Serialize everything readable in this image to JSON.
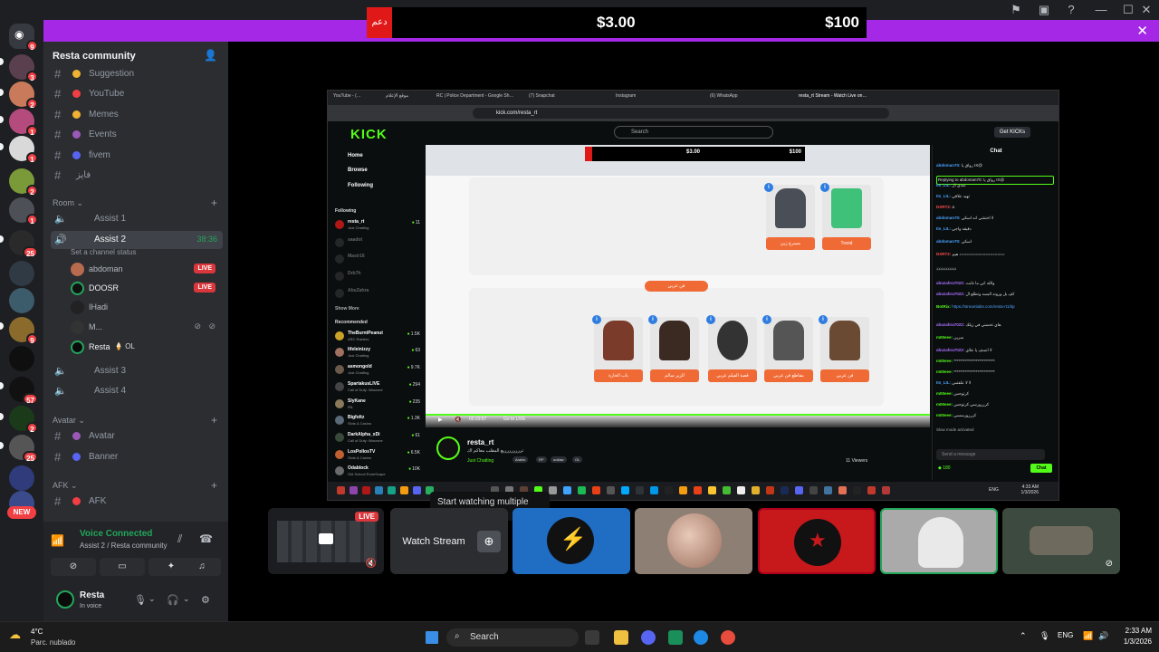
{
  "window": {
    "controls": [
      "flag-icon",
      "inbox-icon",
      "help-icon",
      "minimize",
      "maximize",
      "close"
    ]
  },
  "stream_overlay": {
    "left_text": "دعم",
    "amount_1": "$3.00",
    "amount_2": "$100"
  },
  "rail": {
    "new_label": "NEW",
    "badges": [
      "9",
      "3",
      "2",
      "1",
      "1",
      "2",
      "1",
      "25",
      "9",
      "57",
      "2",
      "25"
    ]
  },
  "server": {
    "name": "Resta community"
  },
  "channels": [
    {
      "label": "Suggestion",
      "color": "#f0b232"
    },
    {
      "label": "YouTube",
      "color": "#f23f43"
    },
    {
      "label": "Memes",
      "color": "#f0b232"
    },
    {
      "label": "Events",
      "color": "#9b59b6"
    },
    {
      "label": "fivem",
      "color": "#5865f2"
    },
    {
      "label": "فايز",
      "color": ""
    }
  ],
  "categories": {
    "room": "Room",
    "avatar": "Avatar",
    "afk": "AFK"
  },
  "voice_channels": {
    "assist1": "Assist 1",
    "assist2": "Assist 2",
    "assist2_time": "38:36",
    "assist2_status": "Set a channel status",
    "assist3": "Assist 3",
    "assist4": "Assist 4",
    "avatar": "Avatar",
    "banner": "Banner",
    "afk": "AFK"
  },
  "voice_users": [
    {
      "name": "abdoman",
      "live": "LIVE"
    },
    {
      "name": "DOOSR",
      "live": "LIVE"
    },
    {
      "name": "IHadi",
      "live": ""
    },
    {
      "name": "M...",
      "live": ""
    },
    {
      "name": "Resta",
      "live": ""
    }
  ],
  "resta_tag": "OL",
  "voice_panel": {
    "title": "Voice Connected",
    "sub": "Assist 2 / Resta community"
  },
  "user": {
    "name": "Resta",
    "status": "In voice"
  },
  "browser": {
    "tabs": [
      "YouTube - (…",
      "موقع الإعلام",
      "RC | Police Department - Google Sh…",
      "(7) Snapchat",
      "Instagram",
      "(6) WhatsApp",
      "resta_rt Stream - Watch Live on…"
    ],
    "url": "kick.com/resta_rt"
  },
  "kick": {
    "search_placeholder": "Search",
    "get_kicks": "Get KICKs",
    "nav": [
      "Home",
      "Browse",
      "Following"
    ],
    "following_header": "Following",
    "following": [
      {
        "name": "resta_rt",
        "sub": "Just Chatting",
        "viewers": "11"
      },
      {
        "name": "saadot",
        "sub": "",
        "viewers": ""
      },
      {
        "name": "Masir16",
        "sub": "",
        "viewers": ""
      },
      {
        "name": "Drb7h",
        "sub": "",
        "viewers": ""
      },
      {
        "name": "AbuZahra",
        "sub": "",
        "viewers": ""
      }
    ],
    "show_more": "Show More",
    "recommended_header": "Recommended",
    "recommended": [
      {
        "name": "TheBurntPeanut",
        "sub": "ARC Raiders",
        "viewers": "1.5K"
      },
      {
        "name": "lifeleinizzy",
        "sub": "Just Chatting",
        "viewers": "63"
      },
      {
        "name": "asmongold",
        "sub": "Just Chatting",
        "viewers": "9.7K"
      },
      {
        "name": "SpartakusLIVE",
        "sub": "Call of Duty: Warzone",
        "viewers": "294"
      },
      {
        "name": "SlyKane",
        "sub": "IRL",
        "viewers": "235"
      },
      {
        "name": "Bigfoltz",
        "sub": "Slots & Casino",
        "viewers": "1.3K"
      },
      {
        "name": "DarkAlpha_xDi",
        "sub": "Call of Duty: Warzone",
        "viewers": "61"
      },
      {
        "name": "LosPollosTV",
        "sub": "Slots & Casino",
        "viewers": "6.5K"
      },
      {
        "name": "Odablock",
        "sub": "Old School RuneScape",
        "viewers": "10K"
      }
    ],
    "video": {
      "top_amount_1": "$3.00",
      "top_amount_2": "$100",
      "cards_top": [
        "مسرح زين",
        "Trend"
      ],
      "pill": "فن عربي",
      "cards_bottom": [
        "باب الحارة",
        "الزير سالم",
        "قصة الفيلم عربي",
        "مقاطع فن عربي",
        "فن عربي"
      ],
      "time": "02:23:57",
      "go_live": "Go to LIVE"
    },
    "channel": {
      "name": "resta_rt",
      "title": "ترررررررريع المقلب معاكم اك",
      "category": "Just Chatting",
      "tags": [
        "Arabic",
        "RP",
        "outlaw",
        "OL"
      ],
      "viewers": "11 Viewers"
    },
    "chat": {
      "title": "Chat",
      "messages": [
        {
          "user": "abdoman70:",
          "text": "رواق يا IX@"
        },
        {
          "user": "Replying to abdoman70:",
          "text": "رواق يا IX@"
        },
        {
          "user": "Its_LIL:",
          "text": "عندي ال"
        },
        {
          "user": "Its_LIL:",
          "text": "تهيد علاقي"
        },
        {
          "user": "DXRT2:",
          "text": "a"
        },
        {
          "user": "abdoman70:",
          "text": "لا احتشي انه اسكي"
        },
        {
          "user": "Its_LIL:",
          "text": "دقيقه واجي"
        },
        {
          "user": "abdoman70:",
          "text": "اسكي"
        },
        {
          "user": "DXRT2:",
          "text": "هيم ==================="
        },
        {
          "user": "",
          "text": "ذذذذذذذذذذذ"
        },
        {
          "user": "abuzahra7022:",
          "text": "والله اني ما غابت"
        },
        {
          "user": "abuzahra7022:",
          "text": "كف بل ورونه البسه وتطلع ال"
        },
        {
          "user": "BotRix:",
          "text": "https://streamlabs.com/resta-rt1/tip"
        },
        {
          "user": "abuzahra7022:",
          "text": "هاي تحسني في زيلك"
        },
        {
          "user": "m00eee:",
          "text": "سرين"
        },
        {
          "user": "abuzahra7022:",
          "text": "لا انسف يا علاي"
        },
        {
          "user": "m00eee:",
          "text": "**************************"
        },
        {
          "user": "m00eee:",
          "text": "**************************"
        },
        {
          "user": "Its_LIL:",
          "text": "لا لا علفتس"
        },
        {
          "user": "m00eee:",
          "text": "كرتوحس"
        },
        {
          "user": "m00eee:",
          "text": "كرررورسي كرتوحس"
        },
        {
          "user": "m00eee:",
          "text": "كرررورسسي"
        }
      ],
      "slow_mode": "Slow mode activated",
      "input_placeholder": "Send a message",
      "points": "180",
      "send": "Chat"
    },
    "inner_taskbar": {
      "time": "4:33 AM",
      "date": "1/3/2026",
      "lang": "ENG"
    }
  },
  "tooltip": "Start watching multiple streams",
  "tiles": {
    "live": "LIVE",
    "watch_stream": "Watch Stream"
  },
  "taskbar": {
    "weather_temp": "4°C",
    "weather_desc": "Parc. nublado",
    "search": "Search",
    "lang": "ENG",
    "time": "2:33 AM",
    "date": "1/3/2026"
  }
}
